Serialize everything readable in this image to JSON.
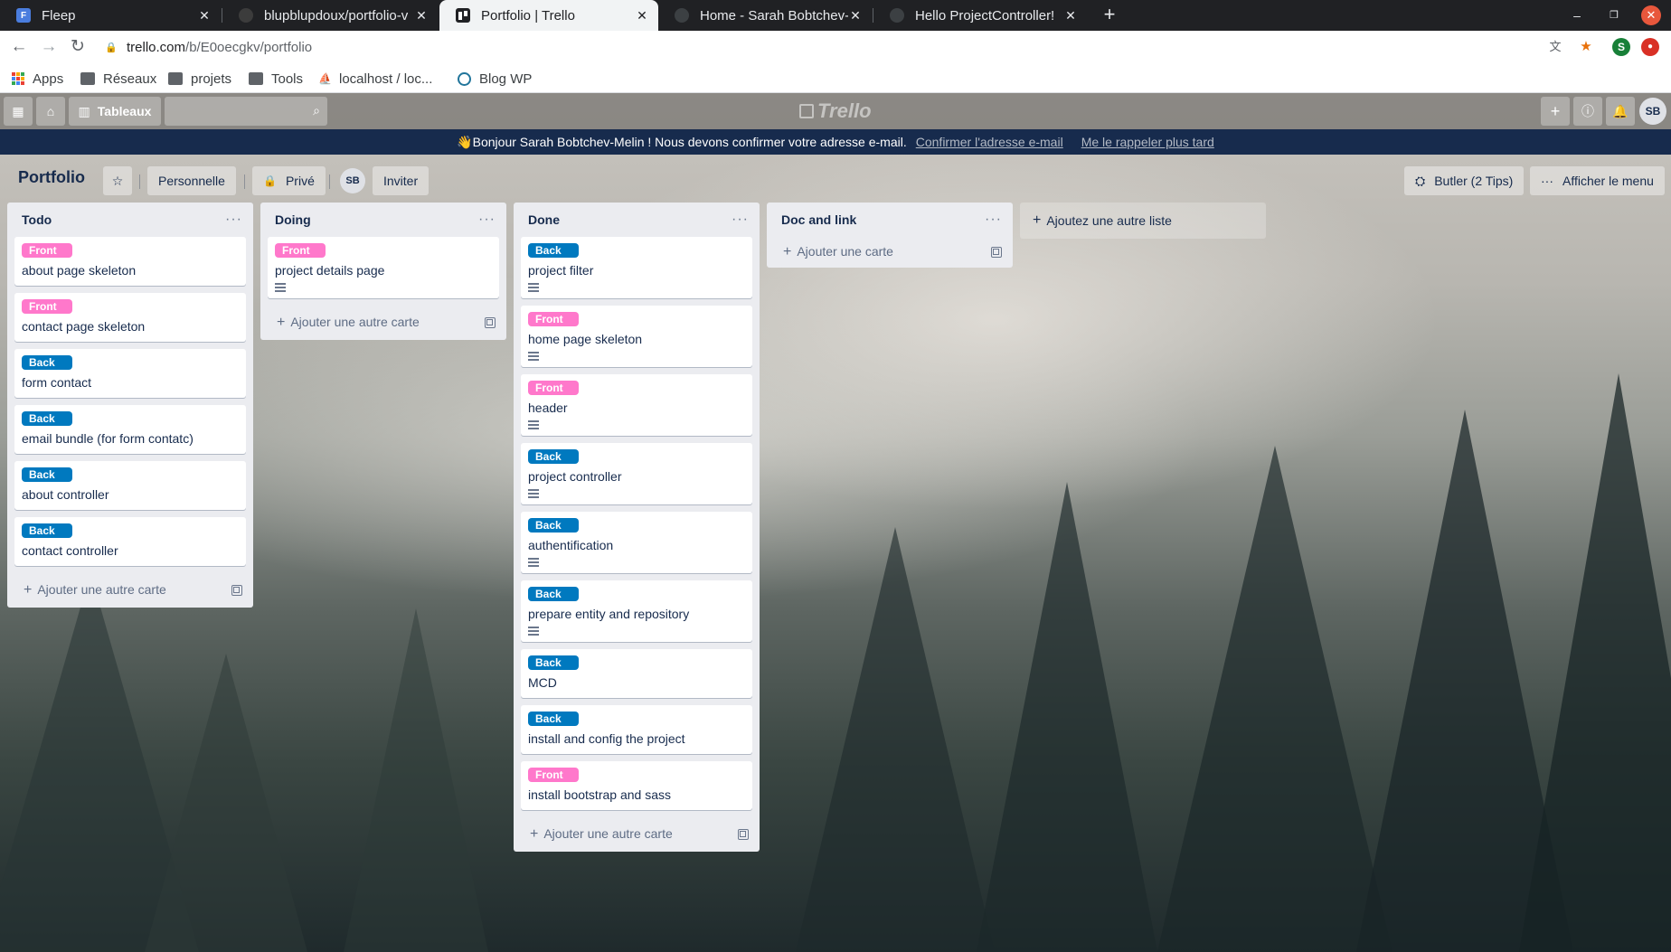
{
  "browser": {
    "tabs": [
      {
        "title": "Fleep",
        "favicon": "F"
      },
      {
        "title": "blupblupdoux/portfolio-v",
        "favicon": "github"
      },
      {
        "title": "Portfolio | Trello",
        "favicon": "trello"
      },
      {
        "title": "Home - Sarah Bobtchev-M",
        "favicon": "globe"
      },
      {
        "title": "Hello ProjectController!",
        "favicon": "globe"
      }
    ],
    "url_domain": "trello.com",
    "url_path": "/b/E0oecgkv/portfolio",
    "profile_initial": "S",
    "bookmarks": [
      "Apps",
      "Réseaux",
      "projets",
      "Tools",
      "localhost / loc...",
      "Blog WP"
    ]
  },
  "trello": {
    "boards_button": "Tableaux",
    "logo_text": "Trello",
    "user_initials": "SB",
    "banner": {
      "message": "👋Bonjour Sarah Bobtchev-Melin ! Nous devons confirmer votre adresse e-mail.",
      "confirm_link": "Confirmer l'adresse e-mail",
      "later_link": "Me le rappeler plus tard"
    },
    "board": {
      "title": "Portfolio",
      "team": "Personnelle",
      "visibility": "Privé",
      "member_initials": "SB",
      "invite": "Inviter",
      "butler": "Butler (2 Tips)",
      "menu": "Afficher le menu"
    },
    "lists": [
      {
        "title": "Todo",
        "add_label": "Ajouter une autre carte",
        "cards": [
          {
            "label": "Front",
            "title": "about page skeleton"
          },
          {
            "label": "Front",
            "title": "contact page skeleton"
          },
          {
            "label": "Back",
            "title": "form contact"
          },
          {
            "label": "Back",
            "title": "email bundle (for form contatc)"
          },
          {
            "label": "Back",
            "title": "about controller"
          },
          {
            "label": "Back",
            "title": "contact controller"
          }
        ]
      },
      {
        "title": "Doing",
        "add_label": "Ajouter une autre carte",
        "cards": [
          {
            "label": "Front",
            "title": "project details page"
          }
        ]
      },
      {
        "title": "Done",
        "add_label": "Ajouter une autre carte",
        "cards": [
          {
            "label": "Back",
            "title": "project filter"
          },
          {
            "label": "Front",
            "title": "home page skeleton"
          },
          {
            "label": "Front",
            "title": "header"
          },
          {
            "label": "Back",
            "title": "project controller"
          },
          {
            "label": "Back",
            "title": "authentification"
          },
          {
            "label": "Back",
            "title": "prepare entity and repository"
          },
          {
            "label": "Back",
            "title": "MCD"
          },
          {
            "label": "Back",
            "title": "install and config the project"
          },
          {
            "label": "Front",
            "title": "install bootstrap and sass"
          }
        ]
      },
      {
        "title": "Doc and link",
        "add_label": "Ajouter une carte",
        "cards": []
      }
    ],
    "add_list": "Ajoutez une autre liste",
    "colors": {
      "front_label": "#ff78cb",
      "back_label": "#0079bf",
      "banner_bg": "#172b4d",
      "list_bg": "#ebecf0"
    }
  }
}
